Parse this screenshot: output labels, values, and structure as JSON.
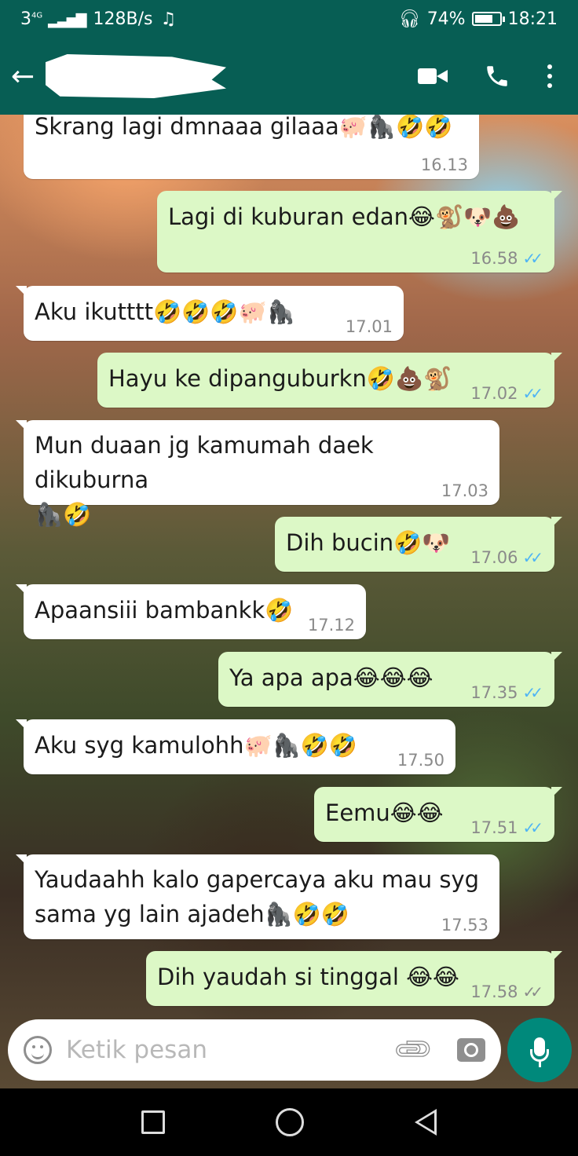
{
  "status_bar": {
    "network": "3",
    "net_type": "4G",
    "speed": "128B/s",
    "battery": "74%",
    "battery_level": 0.74,
    "time": "18:21"
  },
  "header": {
    "icons": [
      "back-arrow-icon",
      "video-call-icon",
      "phone-icon",
      "more-options-icon"
    ]
  },
  "messages": [
    {
      "dir": "in",
      "text": "Skrang lagi dmnaaa gilaaa🐖🦍🤣🤣",
      "time": "16.13"
    },
    {
      "dir": "out",
      "text": "Lagi di kuburan edan😂🐒🐶💩",
      "time": "16.58",
      "status": "read"
    },
    {
      "dir": "in",
      "text": "Aku ikutttt🤣🤣🤣🐖🦍",
      "time": "17.01"
    },
    {
      "dir": "out",
      "text": "Hayu ke dipanguburkn🤣💩🐒",
      "time": "17.02",
      "status": "read"
    },
    {
      "dir": "in",
      "text": "Mun duaan jg kamumah daek dikuburna\n🦍🤣",
      "time": "17.03"
    },
    {
      "dir": "out",
      "text": "Dih bucin🤣🐶",
      "time": "17.06",
      "status": "read"
    },
    {
      "dir": "in",
      "text": "Apaansiii bambankk🤣",
      "time": "17.12"
    },
    {
      "dir": "out",
      "text": "Ya apa apa😂😂😂",
      "time": "17.35",
      "status": "read"
    },
    {
      "dir": "in",
      "text": "Aku syg kamulohh🐖🦍🤣🤣",
      "time": "17.50"
    },
    {
      "dir": "out",
      "text": "Eemu😂😂",
      "time": "17.51",
      "status": "read"
    },
    {
      "dir": "in",
      "text": "Yaudaahh kalo gapercaya aku mau syg\nsama yg lain ajadeh🦍🤣🤣",
      "time": "17.53"
    },
    {
      "dir": "out",
      "text": "Dih yaudah si tinggal 😂😂",
      "time": "17.58",
      "status": "delivered"
    }
  ],
  "composer": {
    "placeholder": "Ketik pesan",
    "value": ""
  },
  "colors": {
    "header": "#075e54",
    "outgoing_bubble": "#dcf8c6",
    "incoming_bubble": "#ffffff",
    "mic_button": "#00897b",
    "read_tick": "#4fb4f4"
  }
}
